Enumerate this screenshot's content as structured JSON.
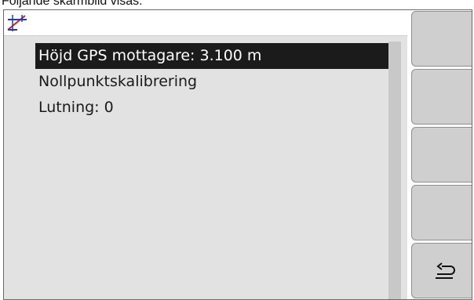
{
  "caption": "Följande skärmbild visas:",
  "header": {
    "icon": "gps-height-calibration-icon"
  },
  "menu": {
    "items": [
      {
        "label": "Höjd GPS mottagare: 3.100 m",
        "selected": true
      },
      {
        "label": "Nollpunktskalibrering",
        "selected": false
      },
      {
        "label": "Lutning: 0",
        "selected": false
      }
    ]
  },
  "softkeys": [
    {
      "icon": ""
    },
    {
      "icon": ""
    },
    {
      "icon": ""
    },
    {
      "icon": ""
    },
    {
      "icon": "back-arrow-icon"
    }
  ],
  "colors": {
    "screen_bg": "#e2e2e2",
    "selection_bg": "#1b1b1b",
    "softkey_bg": "#cfcfcf",
    "icon_red": "#d21e1e",
    "icon_blue": "#1f3fb8"
  }
}
